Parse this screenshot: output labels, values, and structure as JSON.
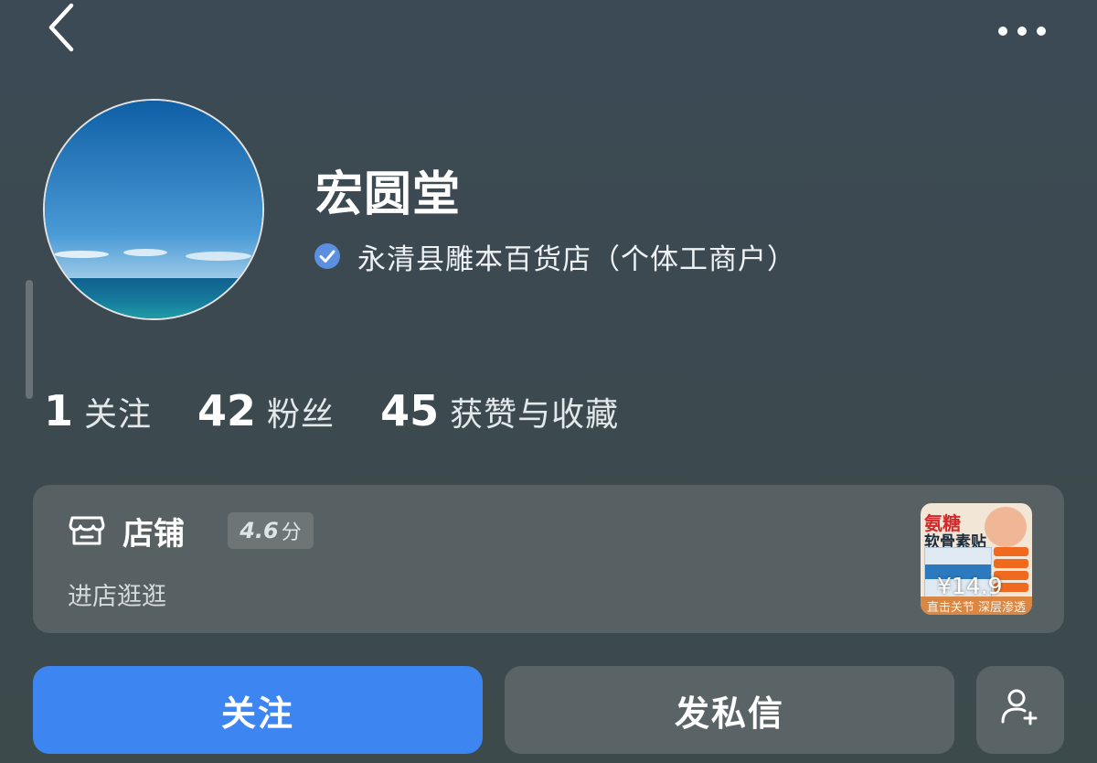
{
  "header": {
    "back_icon": "chevron-left-icon",
    "more_icon": "more-horizontal-icon"
  },
  "profile": {
    "name": "宏圆堂",
    "verified_icon": "verified-check-icon",
    "verified_text": "永清县雕本百货店（个体工商户）"
  },
  "stats": [
    {
      "value": "1",
      "label": "关注"
    },
    {
      "value": "42",
      "label": "粉丝"
    },
    {
      "value": "45",
      "label": "获赞与收藏"
    }
  ],
  "shop": {
    "icon": "storefront-icon",
    "title": "店铺",
    "rating_value": "4.6",
    "rating_unit": "分",
    "subtitle": "进店逛逛",
    "product": {
      "title_line1": "氨糖",
      "title_line2": "软骨素贴",
      "price": "¥14.9",
      "bottom_text": "直击关节 深层渗透"
    }
  },
  "actions": {
    "follow_label": "关注",
    "message_label": "发私信",
    "add_friend_icon": "add-user-icon"
  },
  "colors": {
    "accent": "#3d86f2",
    "verified": "#5b8fe0"
  }
}
